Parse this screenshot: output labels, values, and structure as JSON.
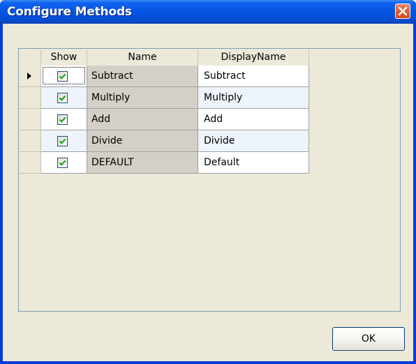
{
  "window": {
    "title": "Configure Methods"
  },
  "grid": {
    "columns": [
      "Show",
      "Name",
      "DisplayName"
    ],
    "rows": [
      {
        "show": true,
        "name": "Subtract",
        "display_name": "Subtract",
        "current": true
      },
      {
        "show": true,
        "name": "Multiply",
        "display_name": "Multiply",
        "current": false
      },
      {
        "show": true,
        "name": "Add",
        "display_name": "Add",
        "current": false
      },
      {
        "show": true,
        "name": "Divide",
        "display_name": "Divide",
        "current": false
      },
      {
        "show": true,
        "name": "DEFAULT",
        "display_name": "Default",
        "current": false
      }
    ]
  },
  "buttons": {
    "ok_label": "OK"
  },
  "colors": {
    "titlebar": "#0656e4",
    "dialog_bg": "#ece9d8",
    "name_column_bg": "#d4d0c8",
    "checkmark": "#21a121",
    "close_button": "#e2673f"
  },
  "icons": {
    "close": "close-icon",
    "row_pointer": "row-pointer-icon",
    "checkmark": "checkmark-icon"
  }
}
